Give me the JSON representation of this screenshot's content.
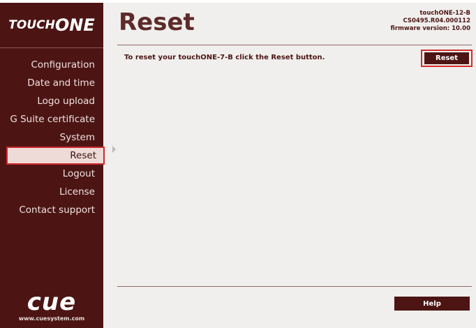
{
  "brand": {
    "logo_part1": "TOUCH",
    "logo_part2": "ONE"
  },
  "sidebar": {
    "items": [
      {
        "label": "Configuration"
      },
      {
        "label": "Date and time"
      },
      {
        "label": "Logo upload"
      },
      {
        "label": "G Suite certificate"
      },
      {
        "label": "System"
      },
      {
        "label": "Reset"
      },
      {
        "label": "Logout"
      },
      {
        "label": "License"
      },
      {
        "label": "Contact support"
      }
    ],
    "active": "Reset"
  },
  "footer_brand": {
    "logo": "cue",
    "url": "www.cuesystem.com"
  },
  "header": {
    "title": "Reset",
    "device_name": "touchONE-12-B",
    "serial": "CS0495.R04.000112",
    "firmware": "firmware version: 10.00"
  },
  "main": {
    "instruction": "To reset your touchONE-7-B click the Reset button.",
    "reset_label": "Reset",
    "help_label": "Help"
  },
  "colors": {
    "sidebar_bg": "#4c1514",
    "accent": "#4c1514",
    "highlight_border": "#d52a2a",
    "content_bg": "#f0efed"
  }
}
